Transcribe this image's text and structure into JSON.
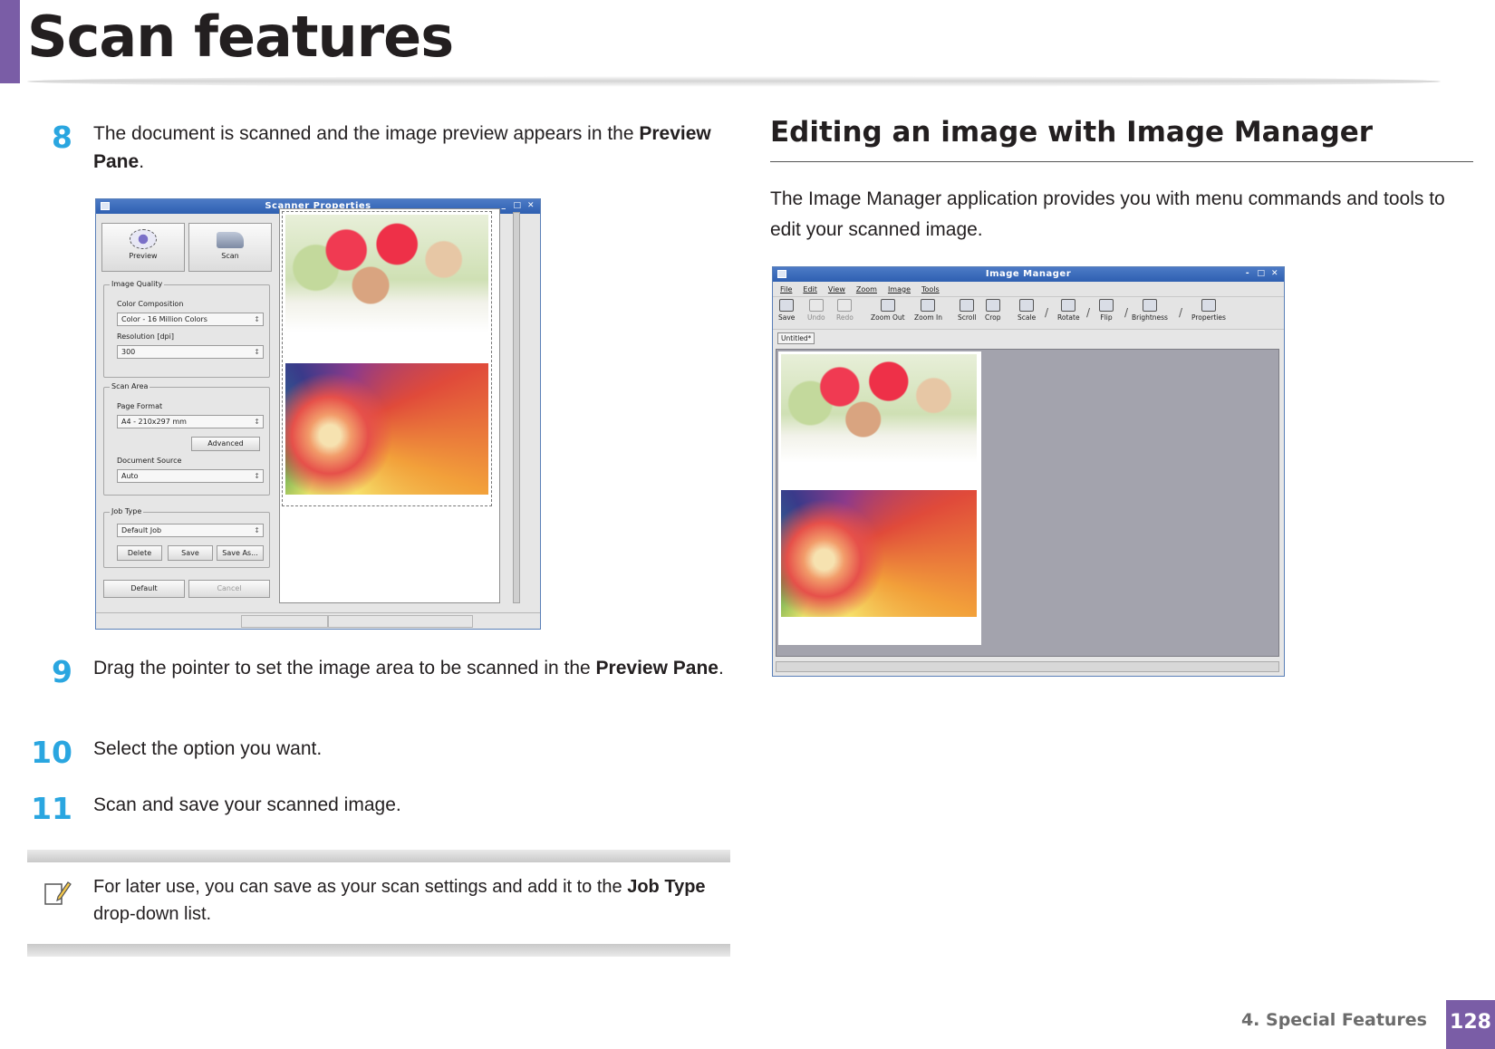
{
  "header": {
    "title": "Scan features"
  },
  "steps": [
    {
      "num": "8",
      "text": "The document is scanned and the image preview appears in the ",
      "bold": "Preview Pane",
      "tail": "."
    },
    {
      "num": "9",
      "text": "Drag the pointer to set the image area to be scanned in the ",
      "bold": "Preview Pane",
      "tail": "."
    },
    {
      "num": "10",
      "text": "Select the option you want."
    },
    {
      "num": "11",
      "text": "Scan and save your scanned image."
    }
  ],
  "note": {
    "text": "For later use, you can save as your scan settings and add it to the ",
    "bold": "Job Type",
    "tail": " drop-down list.",
    "icon": "note-pencil-icon"
  },
  "section": {
    "title": "Editing an image with Image Manager",
    "body": "The Image Manager application provides you with menu commands and tools to edit your scanned image."
  },
  "scanner_window": {
    "title": "Scanner Properties",
    "controls": [
      "_",
      "□",
      "✕"
    ],
    "preview_button": "Preview",
    "scan_button": "Scan",
    "image_quality": {
      "legend": "Image Quality",
      "color_label": "Color Composition",
      "color_value": "Color - 16 Million Colors",
      "resolution_label": "Resolution [dpi]",
      "resolution_value": "300"
    },
    "scan_area": {
      "legend": "Scan Area",
      "page_format_label": "Page Format",
      "page_format_value": "A4 - 210x297 mm",
      "advanced_button": "Advanced",
      "source_label": "Document Source",
      "source_value": "Auto"
    },
    "job_type": {
      "legend": "Job Type",
      "value": "Default Job",
      "delete_button": "Delete",
      "save_button": "Save",
      "save_as_button": "Save As..."
    },
    "default_button": "Default",
    "cancel_button": "Cancel"
  },
  "image_manager": {
    "title": "Image Manager",
    "controls": [
      "-",
      "□",
      "✕"
    ],
    "menu": [
      "File",
      "Edit",
      "View",
      "Zoom",
      "Image",
      "Tools"
    ],
    "tools": [
      "Save",
      "Undo",
      "Redo",
      "Zoom Out",
      "Zoom In",
      "Scroll",
      "Crop",
      "Scale",
      "Rotate",
      "Flip",
      "Brightness",
      "Properties"
    ],
    "tab": "Untitled*"
  },
  "footer": {
    "chapter": "4.  Special Features",
    "page": "128"
  },
  "colors": {
    "accent": "#7a5da6",
    "step_number": "#2aa6e0"
  }
}
